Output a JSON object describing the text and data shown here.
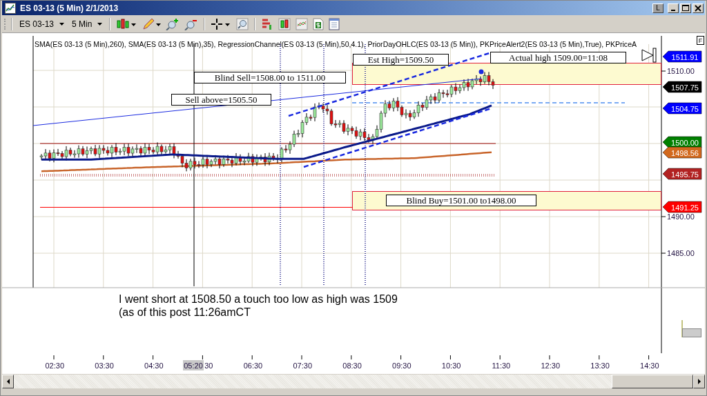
{
  "window": {
    "title": "ES 03-13 (5 Min)  2/1/2013",
    "layout_button": "L"
  },
  "toolbar": {
    "symbol": "ES 03-13",
    "interval": "5 Min"
  },
  "chart": {
    "indicators": "SMA(ES 03-13 (5 Min),260), SMA(ES 03-13 (5 Min),35), RegressionChannel(ES 03-13 (5 Min),50,4.1), PriorDayOHLC(ES 03-13 (5 Min)), PKPriceAlert2(ES 03-13 (5 Min),True), PKPriceA",
    "corner_label": "F",
    "annotations": [
      {
        "text": "Est High=1509.50"
      },
      {
        "text": "Actual high 1509.00=11:08"
      },
      {
        "text": "Blind Sell=1508.00 to 1511.00"
      },
      {
        "text": "Sell above=1505.50"
      },
      {
        "text": "Blind Buy=1501.00 to1498.00"
      }
    ],
    "price_tags": [
      {
        "text": "1511.91",
        "color": "#0000ff"
      },
      {
        "text": "1507.75",
        "color": "#000000"
      },
      {
        "text": "1504.75",
        "color": "#0000ff"
      },
      {
        "text": "1500.00",
        "color": "#008000"
      },
      {
        "text": "1498.56",
        "color": "#d2691e"
      },
      {
        "text": "1495.75",
        "color": "#b22222"
      },
      {
        "text": "1491.25",
        "color": "#ff0000"
      }
    ],
    "price_axis": [
      "1510.00",
      "1490.00",
      "1485.00"
    ],
    "time_axis": [
      "02:30",
      "03:30",
      "04:30",
      "30",
      "06:30",
      "07:30",
      "08:30",
      "09:30",
      "10:30",
      "11:30",
      "12:30",
      "13:30",
      "14:30"
    ],
    "cursor_time": "05:20",
    "comment": [
      "I went short at 1508.50 a touch too low as high was 1509",
      "(as of this post 11:26amCT"
    ]
  }
}
